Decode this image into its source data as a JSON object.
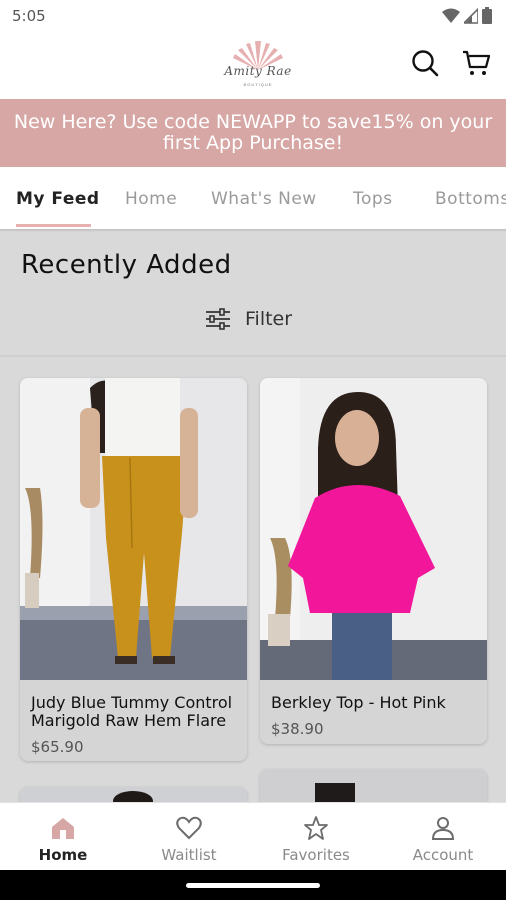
{
  "status_bar": {
    "time": "5:05"
  },
  "header": {
    "logo_text": "Amity Rae",
    "logo_sub": "BOUTIQUE",
    "accent": "#d7a7a5"
  },
  "promo": {
    "text": "New Here? Use code NEWAPP to save15% on your first App Purchase!",
    "background": "#d7a7a5"
  },
  "tabs": [
    {
      "label": "My Feed",
      "active": true
    },
    {
      "label": "Home"
    },
    {
      "label": "What's New"
    },
    {
      "label": "Tops"
    },
    {
      "label": "Bottoms"
    }
  ],
  "feed": {
    "section_title": "Recently Added",
    "filter_label": "Filter",
    "products": [
      {
        "title_line1": "Judy Blue Tummy Control",
        "title_line2": "Marigold Raw Hem Flare",
        "price": "$65.90"
      },
      {
        "title_line1": "Berkley Top - Hot Pink",
        "price": "$38.90"
      }
    ]
  },
  "bottom_nav": [
    {
      "label": "Home",
      "icon": "home-icon",
      "active": true
    },
    {
      "label": "Waitlist",
      "icon": "heart-icon"
    },
    {
      "label": "Favorites",
      "icon": "star-icon"
    },
    {
      "label": "Account",
      "icon": "person-icon"
    }
  ]
}
